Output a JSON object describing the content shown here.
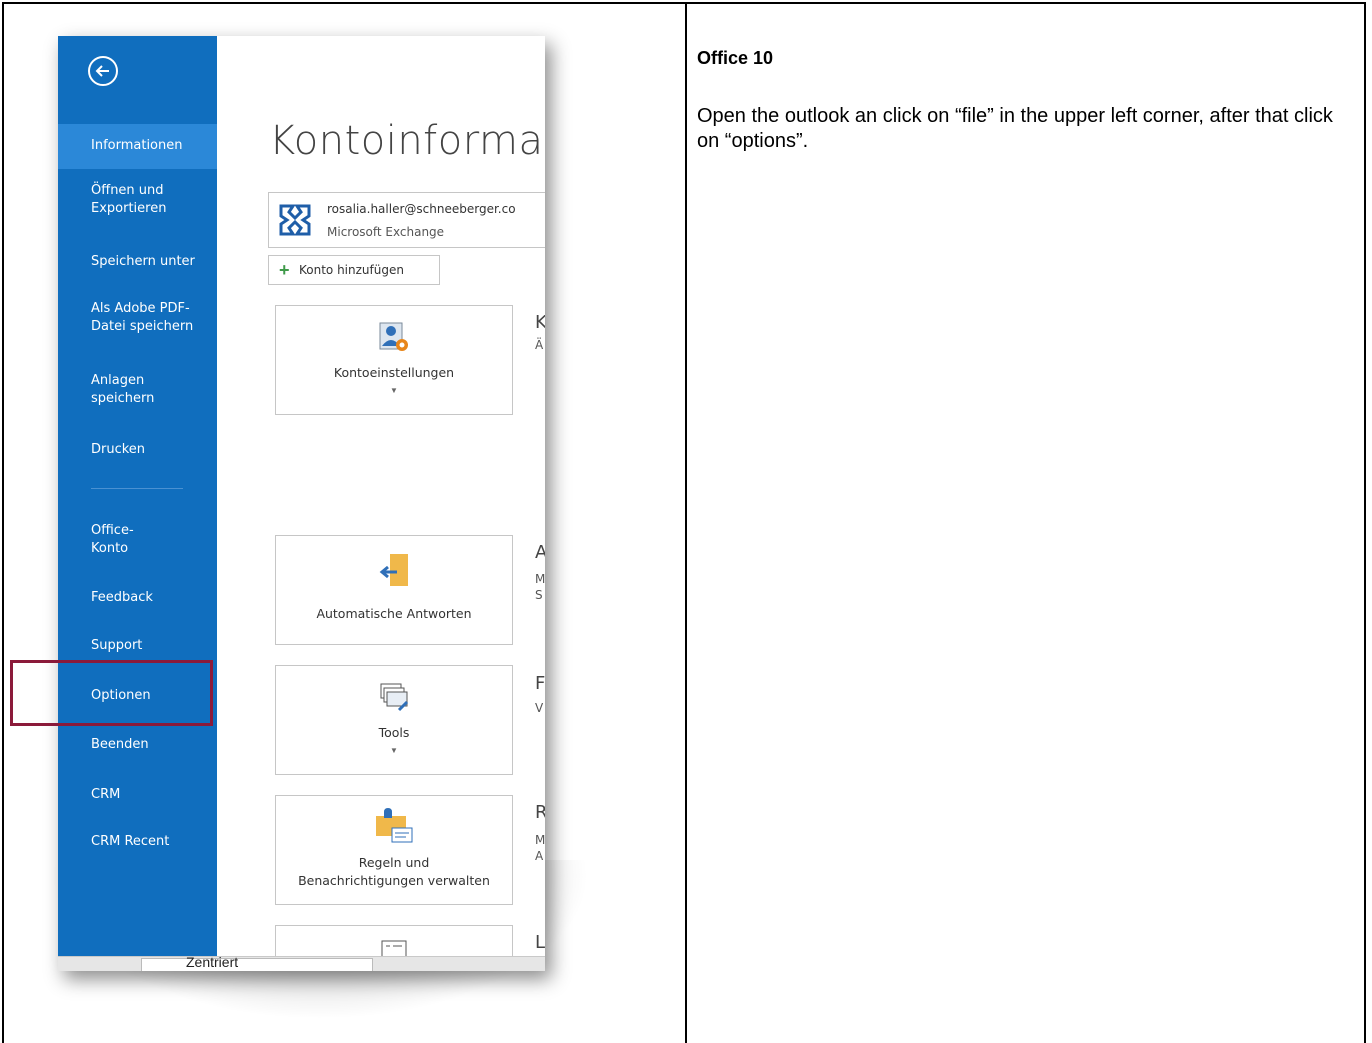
{
  "note": {
    "title": "Office 10",
    "body": "Open the outlook an click on “file” in the upper left corner, after that click on “options”."
  },
  "sidebar": {
    "items": [
      {
        "label": "Informationen"
      },
      {
        "label": "Öffnen und\nExportieren"
      },
      {
        "label": "Speichern unter"
      },
      {
        "label": "Als Adobe PDF-\nDatei speichern"
      },
      {
        "label": "Anlagen\nspeichern"
      },
      {
        "label": "Drucken"
      },
      {
        "label": "Office-\nKonto"
      },
      {
        "label": "Feedback"
      },
      {
        "label": "Support"
      },
      {
        "label": "Optionen"
      },
      {
        "label": "Beenden"
      },
      {
        "label": "CRM"
      },
      {
        "label": "CRM Recent"
      }
    ]
  },
  "main": {
    "title": "Kontoinforma",
    "account_email": "rosalia.haller@schneeberger.co",
    "account_type": "Microsoft Exchange",
    "add_account_label": "Konto hinzufügen",
    "tiles": [
      {
        "label": "Kontoeinstellungen",
        "side_letter": "K",
        "side_sub": "Ä"
      },
      {
        "label": "Automatische Antworten",
        "side_letter": "A",
        "side_sub": "M\nS"
      },
      {
        "label": "Tools",
        "side_letter": "F",
        "side_sub": "V"
      },
      {
        "label": "Regeln und\nBenachrichtigungen verwalten",
        "side_letter": "R",
        "side_sub": "M\nA"
      },
      {
        "label": "",
        "side_letter": "L",
        "side_sub": ""
      }
    ]
  },
  "bottom_bar": {
    "text": "Zentriert"
  },
  "colors": {
    "sidebar": "#106ebe",
    "sidebar_active": "#2b88d8",
    "highlight": "#8b1a3a"
  }
}
